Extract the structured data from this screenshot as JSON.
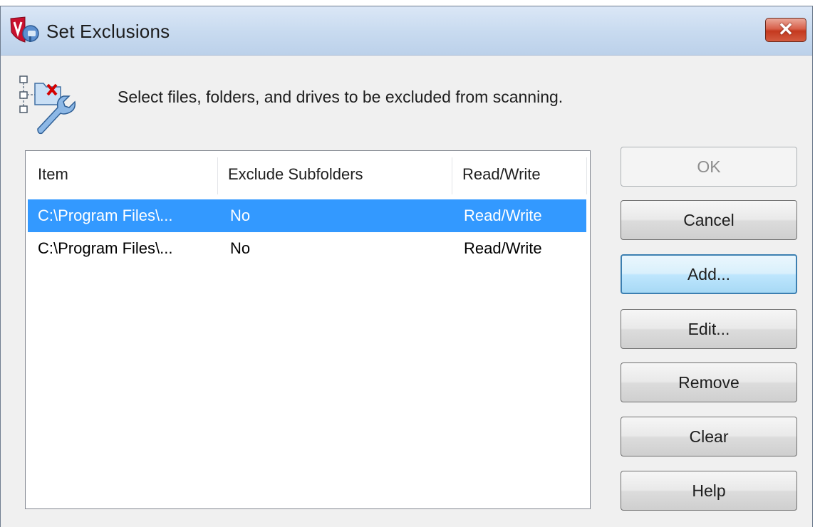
{
  "window": {
    "title": "Set Exclusions",
    "close_glyph": "✕"
  },
  "icons": {
    "app_icon": "mcafee-shield-icon",
    "info_icon": "folder-tree-wrench-icon",
    "close_icon": "close-icon"
  },
  "instruction": "Select files, folders, and drives to be excluded from scanning.",
  "list": {
    "columns": [
      "Item",
      "Exclude Subfolders",
      "Read/Write"
    ],
    "rows": [
      {
        "item": "C:\\Program Files\\...",
        "exclude_subfolders": "No",
        "read_write": "Read/Write",
        "selected": true
      },
      {
        "item": "C:\\Program Files\\...",
        "exclude_subfolders": "No",
        "read_write": "Read/Write",
        "selected": false
      }
    ]
  },
  "buttons": {
    "ok": "OK",
    "cancel": "Cancel",
    "add": "Add...",
    "edit": "Edit...",
    "remove": "Remove",
    "clear": "Clear",
    "help": "Help"
  },
  "colors": {
    "selection": "#3399ff",
    "titlebar": "#c9dbf0",
    "close_button": "#c4391f",
    "dialog_background": "#f0f0f0"
  }
}
